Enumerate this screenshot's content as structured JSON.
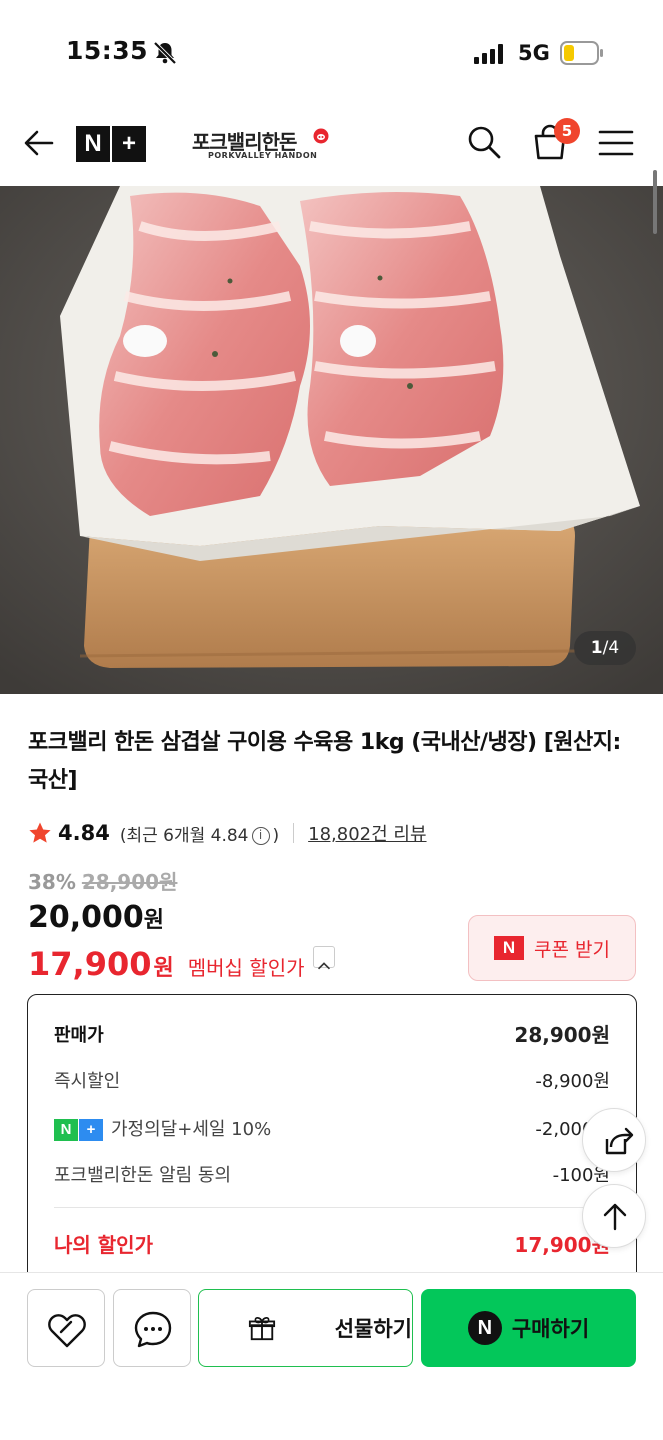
{
  "status_bar": {
    "time": "15:35",
    "network": "5G"
  },
  "header": {
    "logo_left": "N",
    "logo_right": "+",
    "brand_name": "포크밸리한돈",
    "brand_sub": "PORKVALLEY HANDON",
    "cart_count": "5"
  },
  "gallery": {
    "current": "1",
    "total": "/4"
  },
  "product": {
    "title": "포크밸리 한돈 삼겹살 구이용 수육용 1kg (국내산/냉장) [원산지:국산]"
  },
  "rating": {
    "score": "4.84",
    "recent_prefix": "(최근 6개월 4.84",
    "recent_suffix": ")",
    "review_count": "18,802건 리뷰"
  },
  "price": {
    "discount_rate": "38%",
    "original": "28,900원",
    "sale_value": "20,000",
    "sale_unit": "원",
    "member_value": "17,900",
    "member_unit": "원",
    "member_label": "멤버십 할인가",
    "coupon_label": "쿠폰 받기",
    "coupon_icon_text": "N"
  },
  "breakdown": {
    "rows": [
      {
        "label": "판매가",
        "value": "28,900원"
      },
      {
        "label": "즉시할인",
        "value": "-8,900원"
      },
      {
        "label": "가정의달+세일 10%",
        "value": "-2,000원"
      },
      {
        "label": "포크밸리한돈 알림 동의",
        "value": "-100원"
      }
    ],
    "final_label": "나의 할인가",
    "final_value": "17,900원"
  },
  "bottom_bar": {
    "gift_label": "선물하기",
    "buy_label": "구매하기",
    "buy_icon_text": "N"
  },
  "colors": {
    "accent_red": "#e8262f",
    "naver_green": "#03c75a",
    "badge": "#f0452d"
  }
}
